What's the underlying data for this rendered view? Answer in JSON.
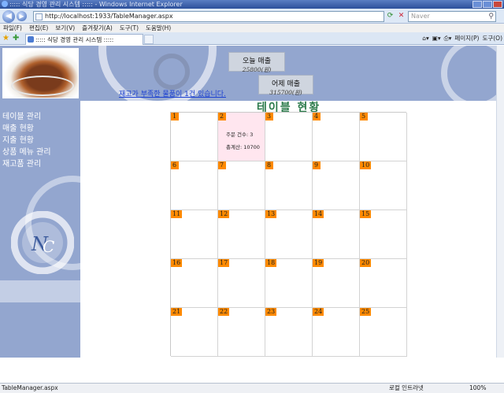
{
  "browser": {
    "window_title": "::::: 식당 경영 관리 시스템 ::::: - Windows Internet Explorer",
    "address": "http://localhost:1933/TableManager.aspx",
    "search_placeholder": "Naver",
    "menu": [
      "파일(F)",
      "편집(E)",
      "보기(V)",
      "즐겨찾기(A)",
      "도구(T)",
      "도움말(H)"
    ],
    "tab_title": "::::: 식당 경영 관리 시스템 :::::",
    "tools": [
      "페이지(P)",
      "도구(O)"
    ],
    "status_text": "TableManager.aspx",
    "zone": "로컬 인트라넷",
    "zoom": "100%"
  },
  "header": {
    "today_label": "오늘 매출",
    "today_value": "25800(원)",
    "yesterday_label": "어제 매출",
    "yesterday_value": "315700(원)",
    "stock_alert": "재고가 부족한 물품이 1건 있습니다."
  },
  "sidebar": {
    "items": [
      "테이블 관리",
      "매출 현황",
      "지출 현황",
      "상품 메뉴 관리",
      "재고품 관리"
    ]
  },
  "main": {
    "title": "테이블 현황",
    "tables": [
      "1",
      "2",
      "3",
      "4",
      "5",
      "6",
      "7",
      "8",
      "9",
      "10",
      "11",
      "12",
      "13",
      "14",
      "15",
      "16",
      "17",
      "18",
      "19",
      "20",
      "21",
      "22",
      "23",
      "24",
      "25"
    ],
    "active_table": {
      "order_count": "주문 건수: 3",
      "total": "총계산: 10700"
    }
  }
}
